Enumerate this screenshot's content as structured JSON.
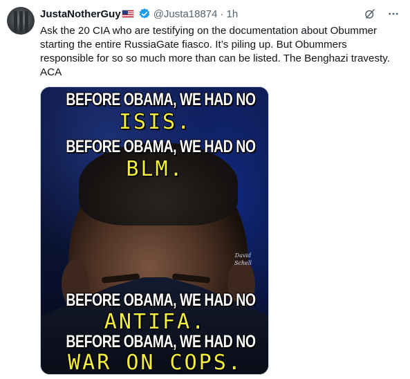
{
  "tweet": {
    "author_name": "JustaNotherGuy",
    "flag_icon": "us-flag-icon",
    "handle": "@Justa18874",
    "separator": "·",
    "time": "1h",
    "text": "Ask the 20 CIA who are testifying on the documentation about Obummer starting the entire RussiaGate fiasco. It’s piling up. But Obummers responsible for so so much more than can be listed. The Benghazi travesty. ACA",
    "icons": {
      "verified": "verified-badge-icon",
      "grok": "grok-icon",
      "more": "more-options-icon"
    },
    "colors": {
      "verified": "#1d9bf0",
      "text": "#0f1419",
      "secondary": "#536471",
      "meme_yellow": "#f4ef3a"
    }
  },
  "media": {
    "lines": [
      {
        "white": "BEFORE OBAMA, WE HAD NO",
        "yellow": "ISIS."
      },
      {
        "white": "BEFORE OBAMA, WE HAD NO",
        "yellow": "BLM."
      },
      {
        "white": "BEFORE OBAMA, WE HAD NO",
        "yellow": "ANTIFA."
      },
      {
        "white": "BEFORE OBAMA, WE HAD NO",
        "yellow": "WAR ON COPS."
      }
    ],
    "signature_line1": "David",
    "signature_line2": "Schell"
  }
}
